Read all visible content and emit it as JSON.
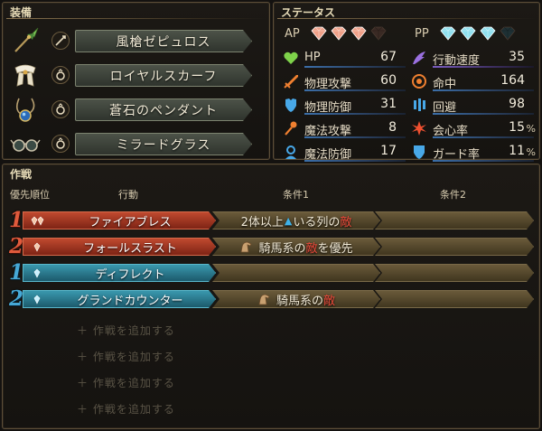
{
  "equipment": {
    "title": "装備",
    "items": [
      {
        "name": "風槍ゼピュロス",
        "icon": "spear-icon",
        "type": "weapon-type-icon"
      },
      {
        "name": "ロイヤルスカーフ",
        "icon": "scarf-icon",
        "type": "accessory-type-icon"
      },
      {
        "name": "蒼石のペンダント",
        "icon": "pendant-icon",
        "type": "accessory-type-icon"
      },
      {
        "name": "ミラードグラス",
        "icon": "glasses-icon",
        "type": "accessory-type-icon"
      }
    ]
  },
  "status": {
    "title": "ステータス",
    "ap_label": "AP",
    "pp_label": "PP",
    "ap_total": 4,
    "ap_filled": 3,
    "pp_total": 4,
    "pp_filled": 3,
    "left": [
      {
        "name": "HP",
        "value": "67",
        "icon": "heart-icon",
        "color": "#7ed24a"
      },
      {
        "name": "物理攻撃",
        "value": "60",
        "icon": "sword-icon",
        "color": "#f08030"
      },
      {
        "name": "物理防御",
        "value": "31",
        "icon": "armor-icon",
        "color": "#48a8e8"
      },
      {
        "name": "魔法攻撃",
        "value": "8",
        "icon": "wand-icon",
        "color": "#f08030"
      },
      {
        "name": "魔法防御",
        "value": "17",
        "icon": "magic-shield-icon",
        "color": "#48a8e8"
      }
    ],
    "right": [
      {
        "name": "行動速度",
        "value": "35",
        "pct": "",
        "icon": "speed-icon",
        "color": "#9a70e0"
      },
      {
        "name": "命中",
        "value": "164",
        "pct": "",
        "icon": "target-icon",
        "color": "#f08030"
      },
      {
        "name": "回避",
        "value": "98",
        "pct": "",
        "icon": "evade-icon",
        "color": "#48a8e8"
      },
      {
        "name": "会心率",
        "value": "15",
        "pct": "%",
        "icon": "critical-icon",
        "color": "#f05030"
      },
      {
        "name": "ガード率",
        "value": "11",
        "pct": "%",
        "icon": "guard-icon",
        "color": "#48a8e8"
      }
    ]
  },
  "tactics": {
    "title": "作戦",
    "col_priority": "優先順位",
    "col_action": "行動",
    "col_cond1": "条件1",
    "col_cond2": "条件2",
    "rows": [
      {
        "priority": "1",
        "kind": "red",
        "action": "ファイアブレス",
        "gems": 2
      },
      {
        "priority": "2",
        "kind": "red",
        "action": "フォールスラスト",
        "gems": 1
      },
      {
        "priority": "1",
        "kind": "blue",
        "action": "ディフレクト",
        "gems": 1
      },
      {
        "priority": "2",
        "kind": "blue",
        "action": "グランドカウンター",
        "gems": 1
      }
    ],
    "cond_r1": {
      "a": "2体以上",
      "b": "いる列の",
      "c": "敵"
    },
    "cond_r2": {
      "a": "騎馬系の",
      "b": "敵",
      "c": "を優先"
    },
    "cond_r4": {
      "a": "騎馬系の",
      "b": "敵"
    },
    "add_label": "＋ 作戦を追加する",
    "add_slots": 4
  }
}
